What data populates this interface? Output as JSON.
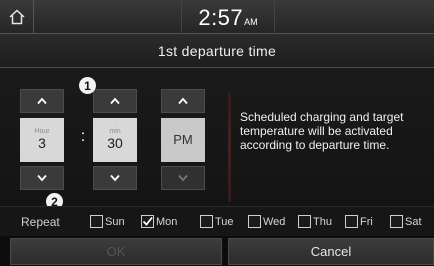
{
  "status_bar": {
    "time": "2:57",
    "ampm": "AM",
    "home_icon": "home-icon"
  },
  "title": "1st departure time",
  "picker": {
    "hour": {
      "label": "Hour",
      "value": "3"
    },
    "minute": {
      "label": "min",
      "value": "30"
    },
    "period": {
      "value": "PM"
    },
    "separator": ":"
  },
  "markers": {
    "one": "1",
    "two": "2"
  },
  "info": "Scheduled charging and target temperature will be activated according to departure time.",
  "repeat": {
    "label": "Repeat",
    "days": [
      {
        "label": "Sun",
        "checked": false
      },
      {
        "label": "Mon",
        "checked": true
      },
      {
        "label": "Tue",
        "checked": false
      },
      {
        "label": "Wed",
        "checked": false
      },
      {
        "label": "Thu",
        "checked": false
      },
      {
        "label": "Fri",
        "checked": false
      },
      {
        "label": "Sat",
        "checked": false
      }
    ]
  },
  "buttons": {
    "ok": "OK",
    "cancel": "Cancel"
  },
  "colors": {
    "background": "#0f0f0f",
    "value_box": "#d8d8d8",
    "button": "#3a3a3a"
  }
}
